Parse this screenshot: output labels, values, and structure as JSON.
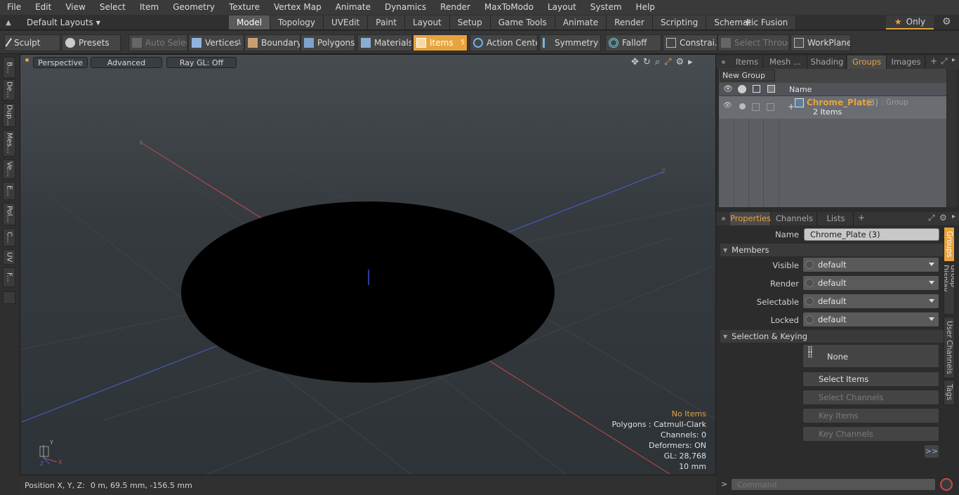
{
  "menu": [
    "File",
    "Edit",
    "View",
    "Select",
    "Item",
    "Geometry",
    "Texture",
    "Vertex Map",
    "Animate",
    "Dynamics",
    "Render",
    "MaxToModo",
    "Layout",
    "System",
    "Help"
  ],
  "layout_label": "Default Layouts",
  "mode_tabs": [
    "Model",
    "Topology",
    "UVEdit",
    "Paint",
    "Layout",
    "Setup",
    "Game Tools",
    "Animate",
    "Render",
    "Scripting",
    "Schematic Fusion"
  ],
  "active_mode_tab": "Model",
  "only_label": "Only",
  "toolbar": {
    "sculpt": "Sculpt",
    "presets": "Presets",
    "auto_select": "Auto Select",
    "vertices": "Vertices",
    "vertices_count": "1",
    "boundary": "Boundary",
    "polygons": "Polygons",
    "materials": "Materials",
    "items": "Items",
    "items_count": "5",
    "action_center": "Action Center",
    "symmetry": "Symmetry",
    "falloff": "Falloff",
    "constraints": "Constrai...",
    "select_through": "Select Through",
    "workplane": "WorkPlane"
  },
  "left_tabs": [
    "B...",
    "De...",
    "Dup...",
    "Mes...",
    "Ve...",
    "E...",
    "Pol...",
    "C...",
    "UV",
    "F..."
  ],
  "viewport": {
    "perspective": "Perspective",
    "advanced": "Advanced",
    "raygl": "Ray GL: Off",
    "info_no_items": "No Items",
    "info_polygons": "Polygons : Catmull-Clark",
    "info_channels": "Channels: 0",
    "info_deformers": "Deformers: ON",
    "info_gl": "GL: 28,768",
    "info_scale": "10 mm",
    "axis_x": "X",
    "axis_y": "Y",
    "axis_z": "Z"
  },
  "status": {
    "position_label": "Position X, Y, Z:",
    "position_value": "0 m, 69.5 mm, -156.5 mm"
  },
  "top_panel_tabs": [
    "Items",
    "Mesh ...",
    "Shading",
    "Groups",
    "Images"
  ],
  "active_top_panel_tab": "Groups",
  "groups": {
    "new_group": "New Group",
    "col_name": "Name",
    "group_name": "Chrome_Plate",
    "group_count": "(3)",
    "group_type": ": Group",
    "group_items": "2 Items"
  },
  "props_tabs": [
    "Properties",
    "Channels",
    "Lists"
  ],
  "properties": {
    "name_label": "Name",
    "name_value": "Chrome_Plate (3)",
    "members_header": "Members",
    "visible_label": "Visible",
    "visible_value": "default",
    "render_label": "Render",
    "render_value": "default",
    "selectable_label": "Selectable",
    "selectable_value": "default",
    "locked_label": "Locked",
    "locked_value": "default",
    "selkey_header": "Selection & Keying",
    "none_label": "None",
    "select_items": "Select Items",
    "select_channels": "Select Channels",
    "key_items": "Key Items",
    "key_channels": "Key Channels",
    "more": ">>"
  },
  "side_tabs": [
    "Groups",
    "Group Display",
    "User Channels",
    "Tags"
  ],
  "command_placeholder": "Command",
  "colors": {
    "accent": "#e8a33d",
    "x_axis": "#c84a4a",
    "z_axis": "#4a5ec8"
  }
}
